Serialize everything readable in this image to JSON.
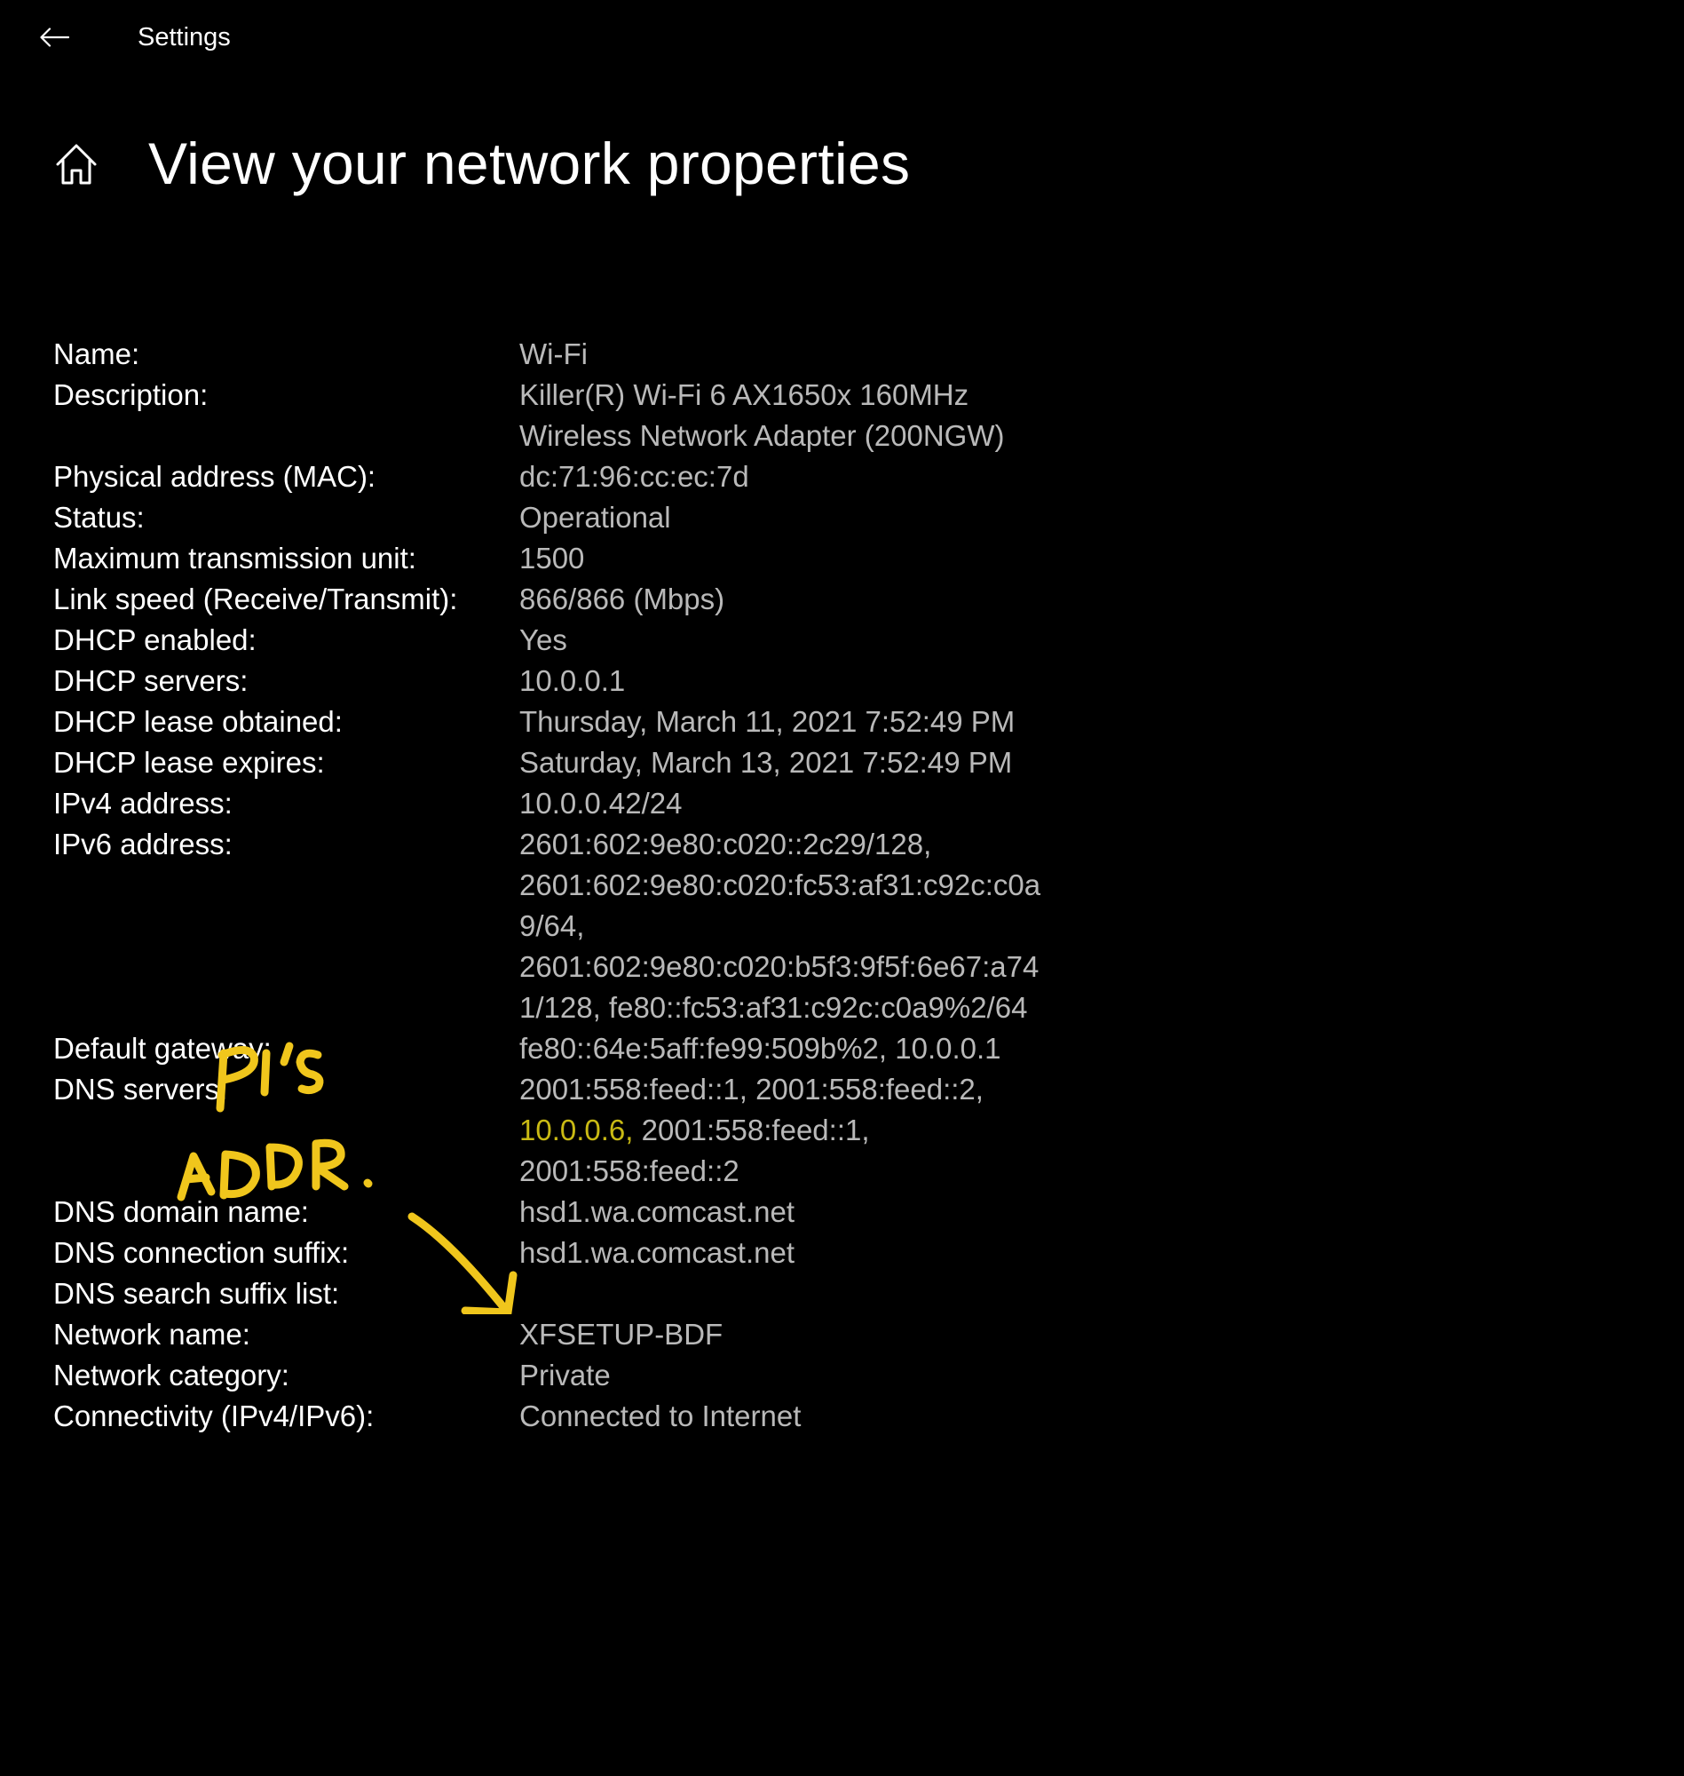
{
  "app": {
    "title": "Settings",
    "back_icon": "back-arrow-icon",
    "home_icon": "home-icon"
  },
  "page": {
    "title": "View your network properties"
  },
  "properties": [
    {
      "key": "name",
      "label": "Name:",
      "lines": [
        "Wi-Fi"
      ]
    },
    {
      "key": "description",
      "label": "Description:",
      "lines": [
        "Killer(R) Wi-Fi 6 AX1650x 160MHz",
        "Wireless Network Adapter (200NGW)"
      ]
    },
    {
      "key": "mac",
      "label": "Physical address (MAC):",
      "lines": [
        "dc:71:96:cc:ec:7d"
      ]
    },
    {
      "key": "status",
      "label": "Status:",
      "lines": [
        "Operational"
      ]
    },
    {
      "key": "mtu",
      "label": "Maximum transmission unit:",
      "lines": [
        "1500"
      ]
    },
    {
      "key": "link-speed",
      "label": "Link speed (Receive/Transmit):",
      "lines": [
        "866/866 (Mbps)"
      ]
    },
    {
      "key": "dhcp-enabled",
      "label": "DHCP enabled:",
      "lines": [
        "Yes"
      ]
    },
    {
      "key": "dhcp-servers",
      "label": "DHCP servers:",
      "lines": [
        "10.0.0.1"
      ]
    },
    {
      "key": "dhcp-lease-obtained",
      "label": "DHCP lease obtained:",
      "lines": [
        "Thursday, March 11, 2021 7:52:49 PM"
      ]
    },
    {
      "key": "dhcp-lease-expires",
      "label": "DHCP lease expires:",
      "lines": [
        "Saturday, March 13, 2021 7:52:49 PM"
      ]
    },
    {
      "key": "ipv4",
      "label": "IPv4 address:",
      "lines": [
        "10.0.0.42/24"
      ]
    },
    {
      "key": "ipv6",
      "label": "IPv6 address:",
      "lines": [
        "2601:602:9e80:c020::2c29/128,",
        "2601:602:9e80:c020:fc53:af31:c92c:c0a",
        "9/64,",
        "2601:602:9e80:c020:b5f3:9f5f:6e67:a74",
        "1/128, fe80::fc53:af31:c92c:c0a9%2/64"
      ]
    },
    {
      "key": "default-gateway",
      "label": "Default gateway:",
      "lines": [
        "fe80::64e:5aff:fe99:509b%2, 10.0.0.1"
      ]
    },
    {
      "key": "dns-servers",
      "label": "DNS servers:",
      "lines": [
        "2001:558:feed::1, 2001:558:feed::2,",
        "10.0.0.6, 2001:558:feed::1,",
        "2001:558:feed::2"
      ]
    },
    {
      "key": "dns-domain",
      "label": "DNS domain name:",
      "lines": [
        "hsd1.wa.comcast.net"
      ]
    },
    {
      "key": "dns-suffix",
      "label": "DNS connection suffix:",
      "lines": [
        "hsd1.wa.comcast.net"
      ]
    },
    {
      "key": "dns-search-suffix",
      "label": "DNS search suffix list:",
      "lines": []
    },
    {
      "key": "network-name",
      "label": "Network name:",
      "lines": [
        "XFSETUP-BDF"
      ]
    },
    {
      "key": "network-category",
      "label": "Network category:",
      "lines": [
        "Private"
      ]
    },
    {
      "key": "connectivity",
      "label": "Connectivity (IPv4/IPv6):",
      "lines": [
        "Connected to Internet"
      ]
    }
  ],
  "highlight": {
    "text": "10.0.0.6,",
    "color": "#c9ba14"
  },
  "annotation": {
    "text": "PI'S ADDR.",
    "color": "#f0c61c"
  },
  "colors": {
    "background": "#000000",
    "label": "#ffffff",
    "value": "#b9b9b9"
  }
}
